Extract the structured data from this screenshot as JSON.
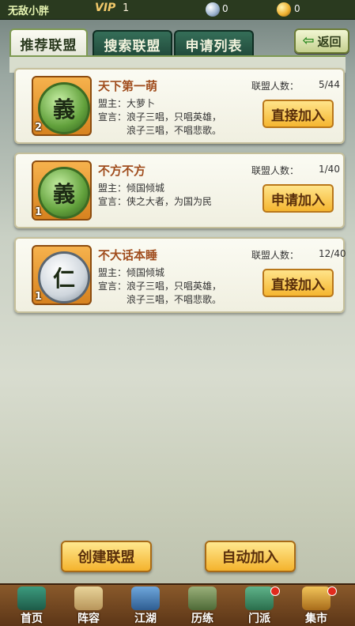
{
  "header": {
    "player_name": "无敌小胖",
    "vip_label": "VIP",
    "vip_level": "1",
    "silver": "0",
    "gold": "0"
  },
  "tabs": [
    {
      "label": "推荐联盟",
      "active": true
    },
    {
      "label": "搜索联盟",
      "active": false
    },
    {
      "label": "申请列表",
      "active": false
    }
  ],
  "back_label": "返回",
  "labels": {
    "members": "联盟人数：",
    "leader": "盟主：",
    "motto": "宣言："
  },
  "alliances": [
    {
      "name": "天下第一萌",
      "members": "5/44",
      "leader": "大萝卜",
      "motto": "浪子三唱，只唱英雄，\n浪子三唱，不唱悲歌。",
      "level": "2",
      "emblem": "義",
      "button": "直接加入"
    },
    {
      "name": "不方不方",
      "members": "1/40",
      "leader": "倾国倾城",
      "motto": "侠之大者，为国为民",
      "level": "1",
      "emblem": "義",
      "button": "申请加入"
    },
    {
      "name": "不大话本睡",
      "members": "12/40",
      "leader": "倾国倾城",
      "motto": "浪子三唱，只唱英雄，\n浪子三唱，不唱悲歌。",
      "level": "1",
      "emblem": "仁",
      "button": "直接加入"
    }
  ],
  "actions": {
    "create": "创建联盟",
    "auto_join": "自动加入"
  },
  "nav": [
    {
      "label": "首页",
      "icon": "home-icon"
    },
    {
      "label": "阵容",
      "icon": "formation-icon"
    },
    {
      "label": "江湖",
      "icon": "jianghu-icon"
    },
    {
      "label": "历练",
      "icon": "training-icon"
    },
    {
      "label": "门派",
      "icon": "sect-icon"
    },
    {
      "label": "集市",
      "icon": "market-icon"
    }
  ],
  "colors": {
    "accent_gold": "#f5b630",
    "name_color": "#a04d1e",
    "tab_active_bg": "#fbfbf2",
    "tab_inactive_bg": "#356e58"
  }
}
